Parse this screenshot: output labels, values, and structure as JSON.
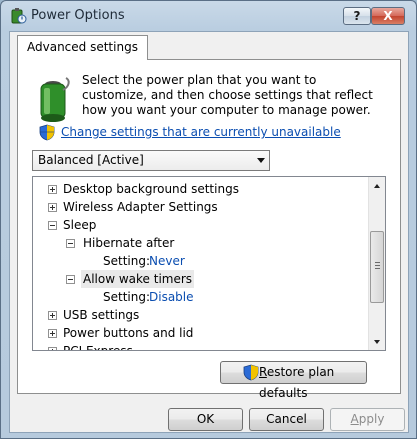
{
  "window": {
    "title": "Power Options",
    "help_label": "?",
    "close_label": "X"
  },
  "tab": {
    "label": "Advanced settings"
  },
  "intro_text": "Select the power plan that you want to customize, and then choose settings that reflect how you want your computer to manage power.",
  "change_link": "Change settings that are currently unavailable",
  "plan_select": {
    "value": "Balanced [Active]"
  },
  "tree": {
    "items": [
      {
        "label": "Desktop background settings",
        "expander": "plus",
        "level": 0
      },
      {
        "label": "Wireless Adapter Settings",
        "expander": "plus",
        "level": 0
      },
      {
        "label": "Sleep",
        "expander": "minus",
        "level": 0
      },
      {
        "label": "Hibernate after",
        "expander": "minus",
        "level": 1
      },
      {
        "label": "Setting:",
        "value": "Never",
        "level": 2
      },
      {
        "label": "Allow wake timers",
        "expander": "minus",
        "level": 1,
        "selected": true
      },
      {
        "label": "Setting:",
        "value": "Disable",
        "level": 2
      },
      {
        "label": "USB settings",
        "expander": "plus",
        "level": 0
      },
      {
        "label": "Power buttons and lid",
        "expander": "plus",
        "level": 0
      },
      {
        "label": "PCI Express",
        "expander": "plus",
        "level": 0
      }
    ]
  },
  "buttons": {
    "restore_prefix": "R",
    "restore_rest": "estore plan defaults",
    "ok": "OK",
    "cancel": "Cancel",
    "apply_prefix": "A",
    "apply_rest": "pply"
  },
  "colors": {
    "link": "#0a4db0",
    "title_bar": "#b9cde0"
  }
}
